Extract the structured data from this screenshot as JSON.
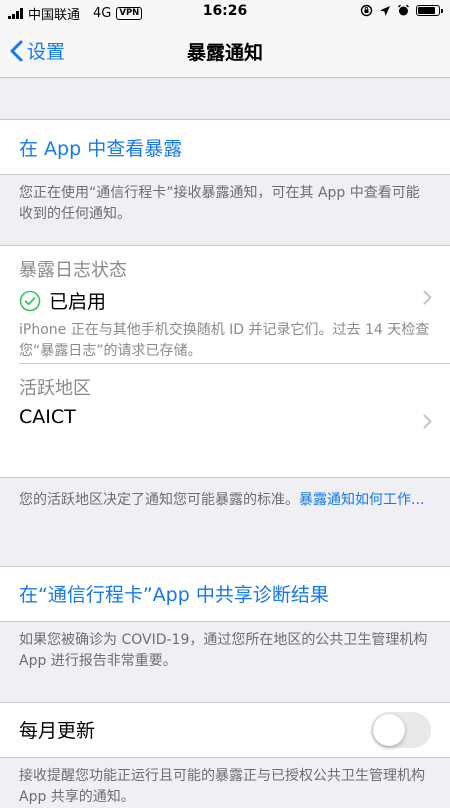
{
  "status_bar": {
    "carrier": "中国联通",
    "network": "4G",
    "vpn": "VPN",
    "time": "16:26"
  },
  "nav": {
    "back_label": "设置",
    "title": "暴露通知"
  },
  "view_exposures": {
    "link": "在 App 中查看暴露",
    "footer": "您正在使用“通信行程卡”接收暴露通知，可在其 App 中查看可能收到的任何通知。"
  },
  "log_status": {
    "label": "暴露日志状态",
    "value": "已启用",
    "description": "iPhone 正在与其他手机交换随机 ID 并记录它们。过去 14 天检查您“暴露日志”的请求已存储。"
  },
  "region": {
    "label": "活跃地区",
    "value": "CAICT",
    "footer": "您的活跃地区决定了通知您可能暴露的标准。",
    "footer_link": "暴露通知如何工作..."
  },
  "share_results": {
    "link": "在“通信行程卡”App 中共享诊断结果",
    "footer": "如果您被确诊为 COVID-19，通过您所在地区的公共卫生管理机构 App 进行报告非常重要。"
  },
  "monthly_update": {
    "label": "每月更新",
    "enabled": false,
    "footer": "接收提醒您功能正运行且可能的暴露正与已授权公共卫生管理机构 App 共享的通知。"
  },
  "colors": {
    "accent": "#1478f0",
    "enabled_green": "#34c759",
    "background": "#efeff4"
  }
}
